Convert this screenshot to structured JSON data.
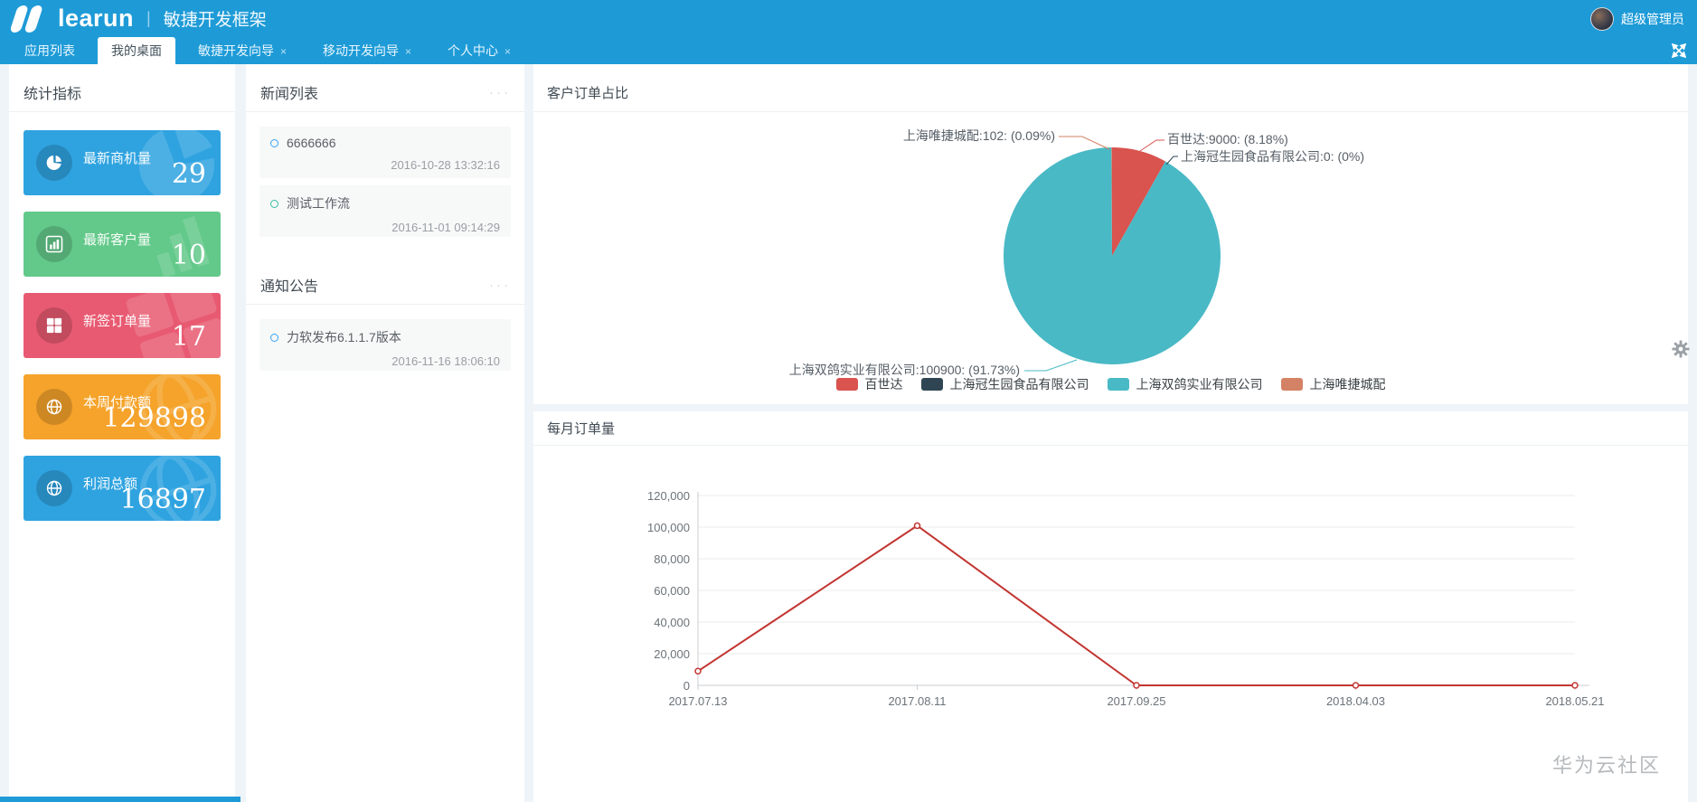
{
  "header": {
    "brand": "learun",
    "divider": "|",
    "app_title": "敏捷开发框架",
    "username": "超级管理员"
  },
  "icons": {
    "close": "×",
    "menu_dots": "···"
  },
  "tabs": [
    {
      "label": "应用列表",
      "active": false,
      "closable": false
    },
    {
      "label": "我的桌面",
      "active": true,
      "closable": false
    },
    {
      "label": "敏捷开发向导",
      "active": false,
      "closable": true
    },
    {
      "label": "移动开发向导",
      "active": false,
      "closable": true
    },
    {
      "label": "个人中心",
      "active": false,
      "closable": true
    }
  ],
  "stats": {
    "title": "统计指标",
    "cards": [
      {
        "label": "最新商机量",
        "value": "29",
        "color": "#2fa3e0",
        "icon": "pie-chart-icon"
      },
      {
        "label": "最新客户量",
        "value": "10",
        "color": "#63c98a",
        "icon": "bar-chart-icon"
      },
      {
        "label": "新签订单量",
        "value": "17",
        "color": "#e85a71",
        "icon": "windows-grid-icon"
      },
      {
        "label": "本周付款额",
        "value": "129898",
        "color": "#f5a32b",
        "icon": "globe-icon"
      },
      {
        "label": "利润总额",
        "value": "16897",
        "color": "#2fa3e0",
        "icon": "globe-icon"
      }
    ]
  },
  "news": {
    "title": "新闻列表",
    "items": [
      {
        "title": "6666666",
        "time": "2016-10-28 13:32:16",
        "bullet_color": "#36a3f7"
      },
      {
        "title": "测试工作流",
        "time": "2016-11-01 09:14:29",
        "bullet_color": "#34bfa3"
      }
    ]
  },
  "notice": {
    "title": "通知公告",
    "items": [
      {
        "title": "力软发布6.1.1.7版本",
        "time": "2016-11-16 18:06:10",
        "bullet_color": "#36a3f7"
      }
    ]
  },
  "pie_panel": {
    "title": "客户订单占比"
  },
  "line_panel": {
    "title": "每月订单量"
  },
  "watermark": "华为云社区",
  "chart_data": [
    {
      "type": "pie",
      "title": "客户订单占比",
      "legend_position": "bottom",
      "label_format": "name:value: (pct)",
      "series": [
        {
          "name": "百世达",
          "value": 9000,
          "pct": "8.18%",
          "color": "#d9534f"
        },
        {
          "name": "上海冠生园食品有限公司",
          "value": 0,
          "pct": "0%",
          "color": "#2f4554"
        },
        {
          "name": "上海双鸽实业有限公司",
          "value": 100900,
          "pct": "91.73%",
          "color": "#49b9c5"
        },
        {
          "name": "上海唯捷城配",
          "value": 102,
          "pct": "0.09%",
          "color": "#d48265"
        }
      ]
    },
    {
      "type": "line",
      "title": "每月订单量",
      "x": [
        "2017.07.13",
        "2017.08.11",
        "2017.09.25",
        "2018.04.03",
        "2018.05.21"
      ],
      "series": [
        {
          "name": "每月订单量",
          "values": [
            9000,
            100900,
            0,
            0,
            0
          ],
          "color": "#c23531"
        }
      ],
      "ylim": [
        0,
        120000
      ],
      "ytick_step": 20000,
      "grid": true,
      "legend_position": "none"
    }
  ]
}
